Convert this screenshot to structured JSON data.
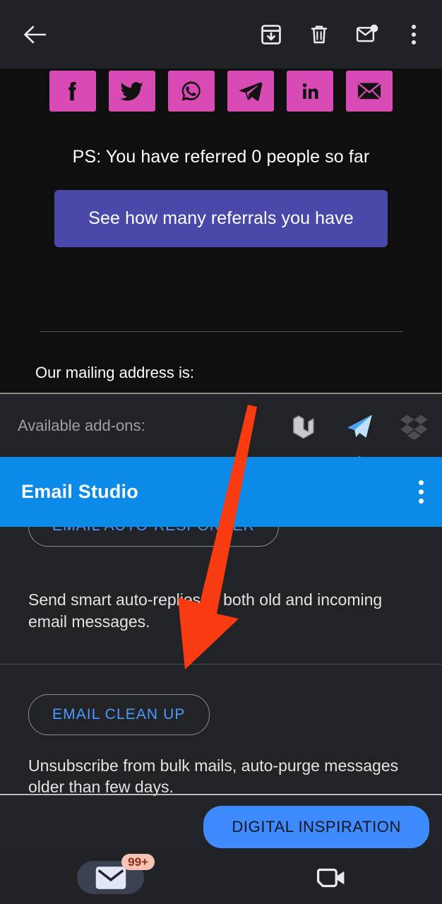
{
  "toolbar": {
    "back_label": "Back",
    "actions": [
      {
        "name": "archive-icon",
        "label": "Archive"
      },
      {
        "name": "delete-icon",
        "label": "Delete"
      },
      {
        "name": "mark-unread-icon",
        "label": "Mark unread"
      },
      {
        "name": "more-options-icon",
        "label": "More options"
      }
    ]
  },
  "email": {
    "social_buttons": [
      {
        "icon": "facebook-icon",
        "label": "Facebook"
      },
      {
        "icon": "twitter-icon",
        "label": "Twitter"
      },
      {
        "icon": "whatsapp-icon",
        "label": "WhatsApp"
      },
      {
        "icon": "telegram-icon",
        "label": "Telegram"
      },
      {
        "icon": "linkedin-icon",
        "label": "LinkedIn"
      },
      {
        "icon": "email-icon",
        "label": "Email"
      }
    ],
    "ps_text": "PS: You have referred 0 people so far",
    "referral_button": "See how many referrals you have",
    "mailing_address_label": "Our mailing address is:"
  },
  "addons": {
    "label": "Available add-ons:",
    "items": [
      {
        "icon": "cube-outline-icon",
        "label": "Add-on",
        "selected": false
      },
      {
        "icon": "paper-plane-icon",
        "label": "Email Studio",
        "selected": true
      },
      {
        "icon": "dropbox-icon",
        "label": "Dropbox",
        "selected": false
      }
    ]
  },
  "studio": {
    "title": "Email Studio",
    "menu_label": "More options",
    "sections": [
      {
        "button": "EMAIL AUTO-RESPONDER",
        "description": "Send smart auto-replies to both old and incoming email messages."
      },
      {
        "button": "EMAIL CLEAN UP",
        "description": "Unsubscribe from bulk mails, auto-purge messages older than few days."
      }
    ],
    "brand_button": "DIGITAL INSPIRATION"
  },
  "bottom_nav": [
    {
      "icon": "mail-icon",
      "label": "Mail",
      "badge": "99+",
      "selected": true
    },
    {
      "icon": "video-camera-icon",
      "label": "Meet",
      "badge": "",
      "selected": false
    }
  ],
  "colors": {
    "social_pink": "#d94bb4",
    "referral_purple": "#4a48a8",
    "studio_blue": "#0b8ae8",
    "brand_blue": "#3d8bff",
    "link_blue": "#4c9aff",
    "badge_bg": "#f7c3b4",
    "annotation_red": "#f93b12"
  }
}
